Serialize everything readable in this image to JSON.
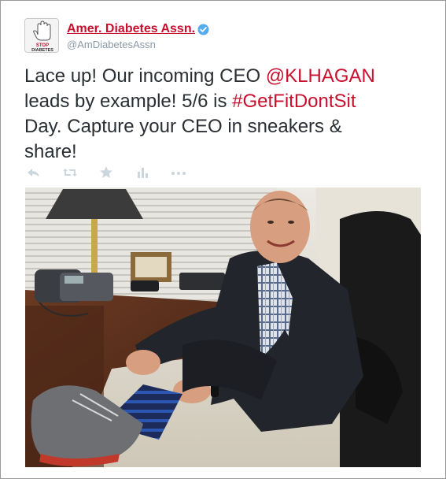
{
  "account": {
    "display_name": "Amer. Diabetes Assn.",
    "handle": "@AmDiabetesAssn",
    "verified": true,
    "avatar_icon": "stop-diabetes-logo",
    "avatar_text_top": "STOP",
    "avatar_text_bottom": "DIABETES"
  },
  "tweet": {
    "lines": [
      [
        {
          "t": "Lace up! Our incoming CEO "
        },
        {
          "t": "@KLHAGAN",
          "link": true
        }
      ],
      [
        {
          "t": "leads by example! 5/6 is "
        },
        {
          "t": "#GetFitDontSit",
          "link": true
        }
      ],
      [
        {
          "t": "Day. Capture your CEO in sneakers &"
        }
      ],
      [
        {
          "t": "share!"
        }
      ]
    ]
  },
  "actions": [
    "reply-icon",
    "retweet-icon",
    "favorite-icon",
    "analytics-icon",
    "more-icon"
  ],
  "colors": {
    "brand_red": "#c8102e",
    "text": "#292f33",
    "muted": "#8899a6",
    "action_icon": "#ccd6dd",
    "verified": "#55acee"
  },
  "photo": {
    "subject": "photo"
  }
}
